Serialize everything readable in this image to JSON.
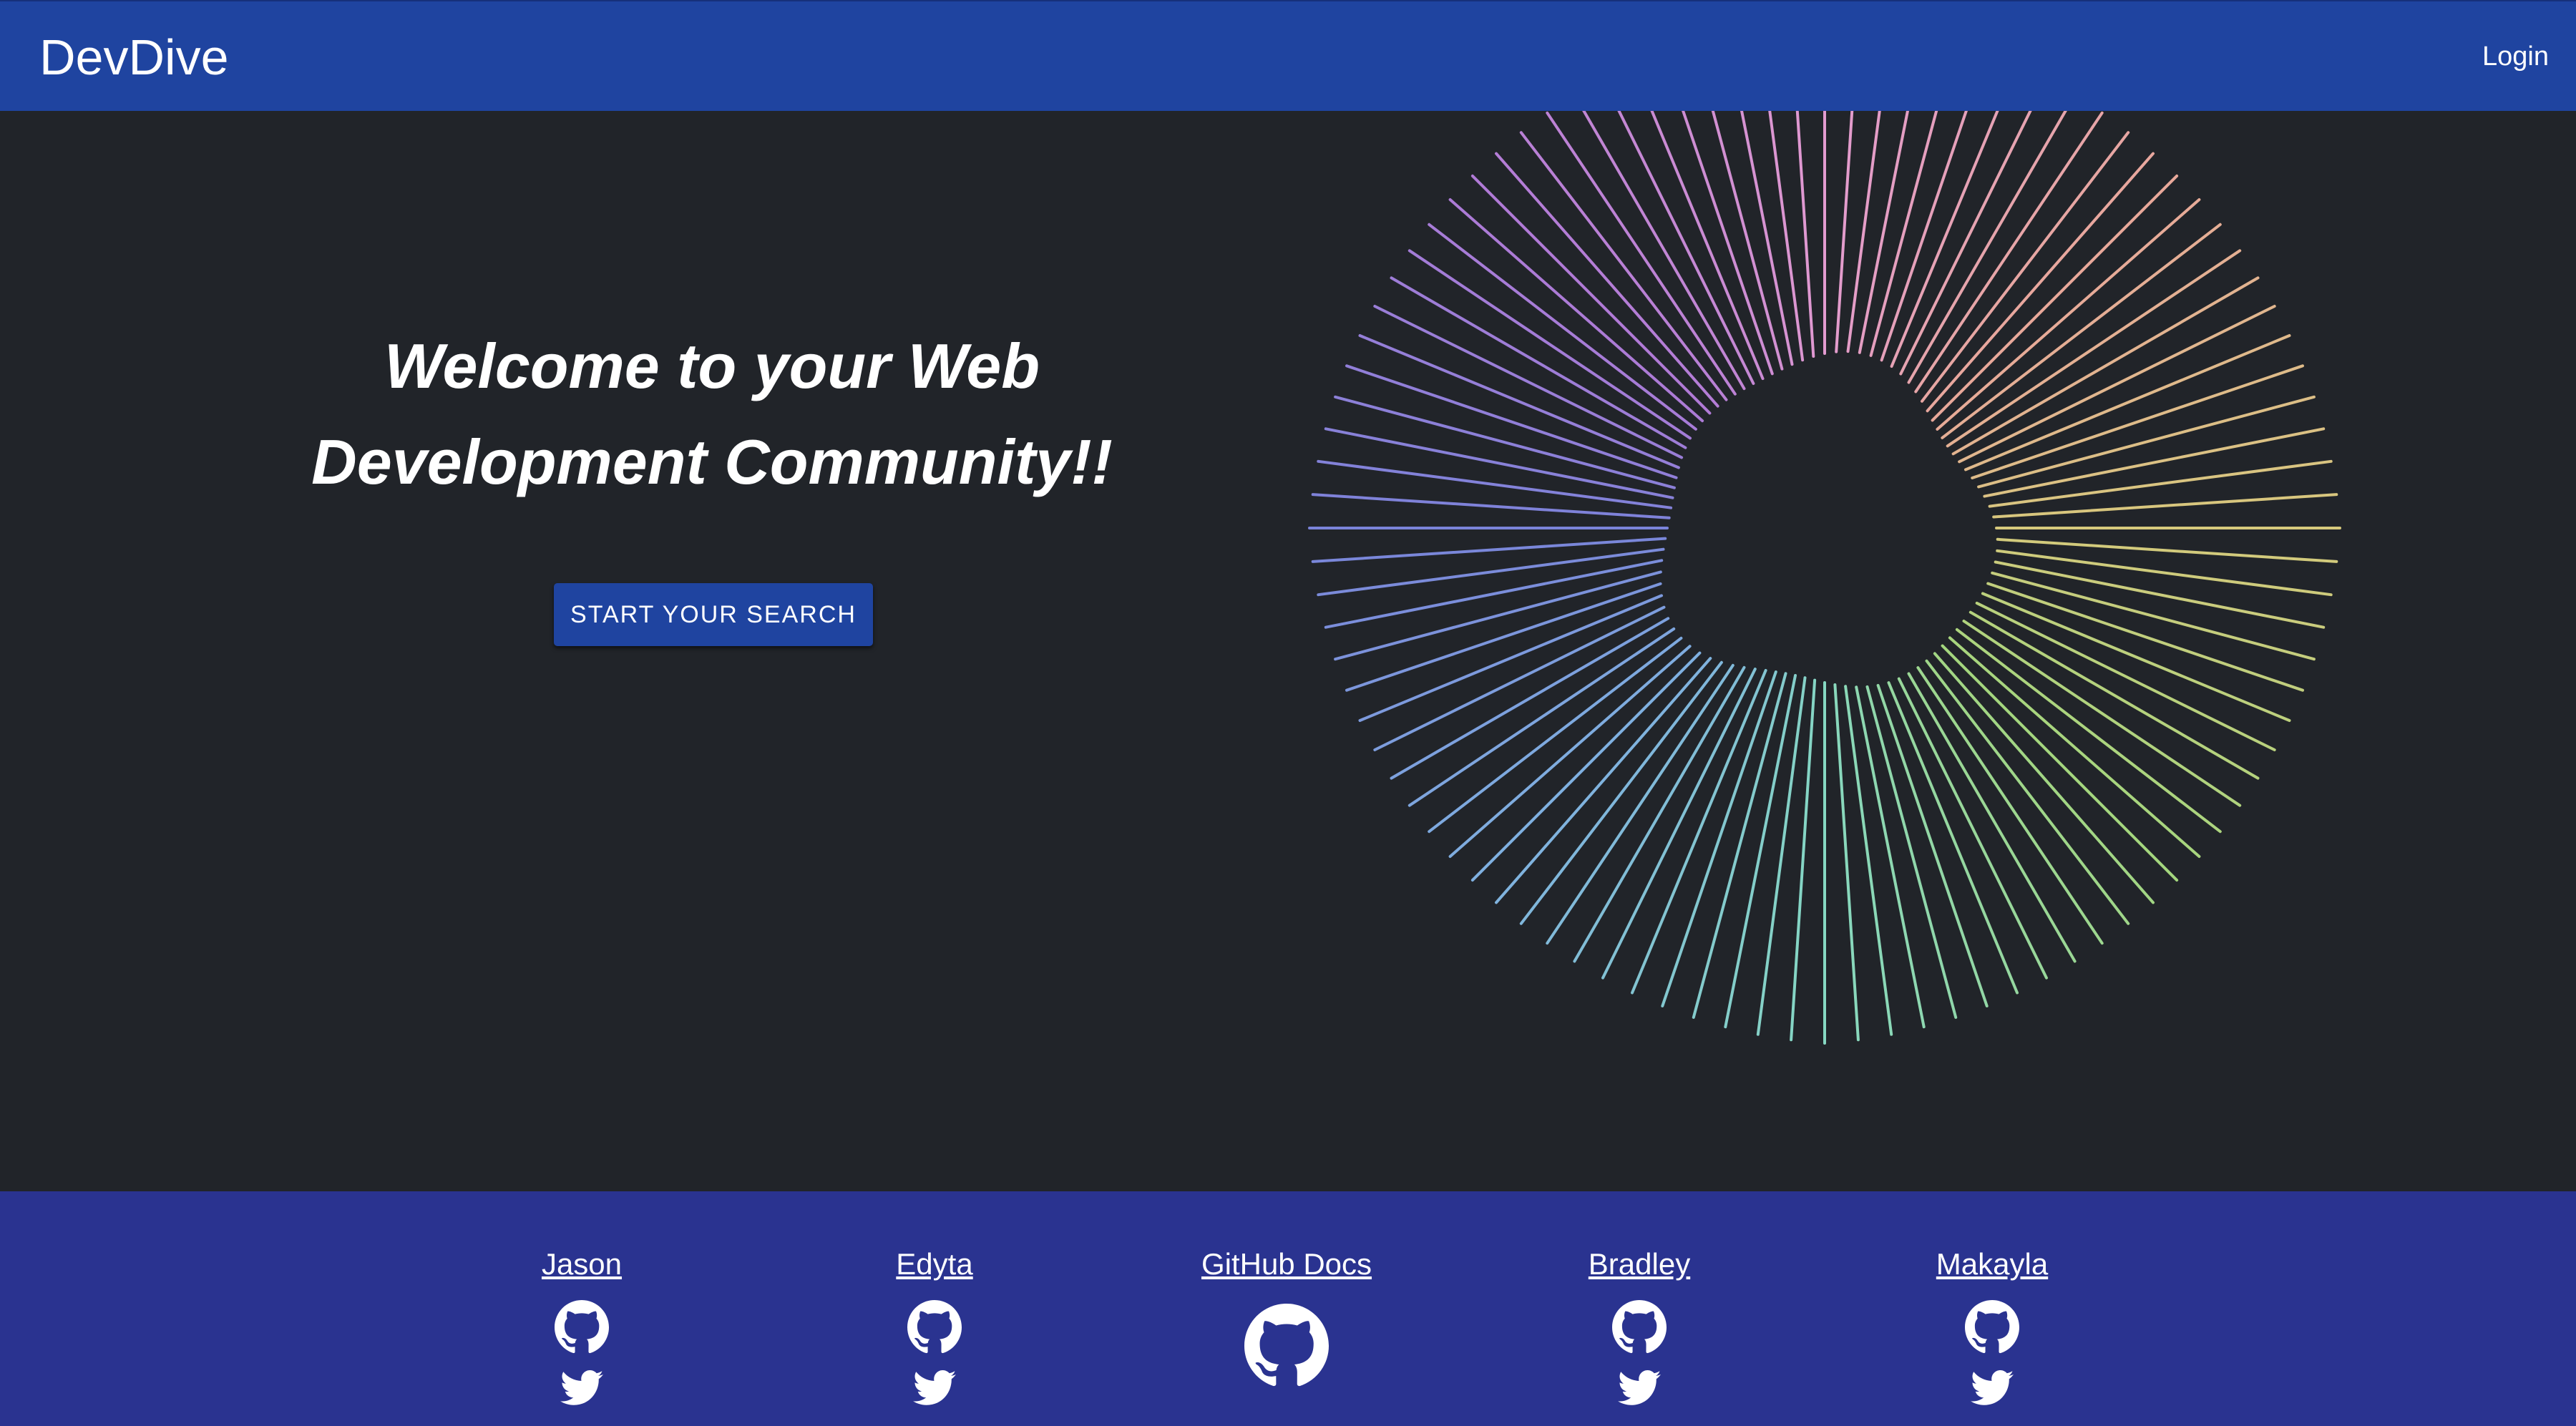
{
  "header": {
    "brand": "DevDive",
    "login_label": "Login",
    "background": "#1f44a0"
  },
  "hero": {
    "heading_line1": "Welcome to your Web",
    "heading_line2": "Development Community!!",
    "cta_label": "START YOUR SEARCH",
    "background": "#212429"
  },
  "footer": {
    "background": "#2a3390",
    "links": [
      {
        "label": "Jason",
        "icons": [
          "github-icon",
          "twitter-icon"
        ]
      },
      {
        "label": "Edyta",
        "icons": [
          "github-icon",
          "twitter-icon"
        ]
      },
      {
        "label": "GitHub Docs",
        "icons": [
          "github-icon"
        ]
      },
      {
        "label": "Bradley",
        "icons": [
          "github-icon",
          "twitter-icon"
        ]
      },
      {
        "label": "Makayla",
        "icons": [
          "github-icon",
          "twitter-icon"
        ]
      }
    ]
  },
  "decoration": {
    "name": "rainbow-radial-burst",
    "colors": [
      "#e39bd0",
      "#b07ad6",
      "#7a83d9",
      "#7fb0e0",
      "#86d8c2",
      "#a4d67e",
      "#d6c97c",
      "#e8a89a"
    ]
  }
}
